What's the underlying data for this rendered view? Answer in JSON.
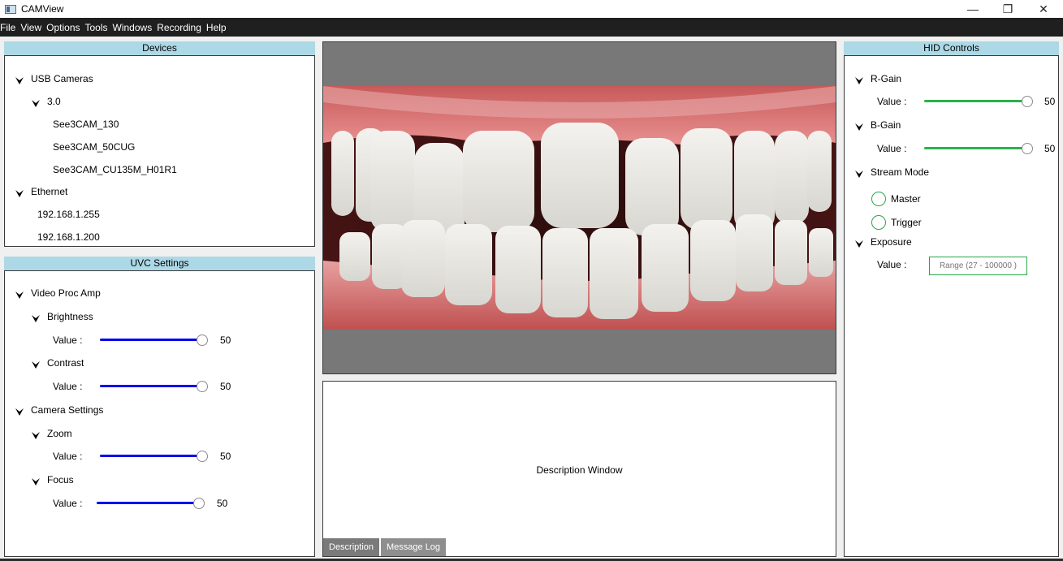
{
  "window": {
    "title": "CAMView",
    "minimize": "—",
    "restore": "❐",
    "close": "✕"
  },
  "menu": [
    "File",
    "View",
    "Options",
    "Tools",
    "Windows",
    "Recording",
    "Help"
  ],
  "devices": {
    "header": "Devices",
    "usb_cameras": "USB Cameras",
    "usb_version": "3.0",
    "cameras": [
      "See3CAM_130",
      "See3CAM_50CUG",
      "See3CAM_CU135M_H01R1"
    ],
    "ethernet": "Ethernet",
    "ethernet_ips": [
      "192.168.1.255",
      "192.168.1.200"
    ]
  },
  "uvc": {
    "header": "UVC Settings",
    "video_proc_amp": "Video Proc Amp",
    "brightness": "Brightness",
    "brightness_value": "50",
    "contrast": "Contrast",
    "contrast_value": "50",
    "camera_settings": "Camera Settings",
    "zoom": "Zoom",
    "zoom_value": "50",
    "focus": "Focus",
    "focus_value": "50",
    "value_label": "Value :"
  },
  "hid": {
    "header": "HID Controls",
    "r_gain": "R-Gain",
    "r_gain_value": "50",
    "b_gain": "B-Gain",
    "b_gain_value": "50",
    "stream_mode": "Stream Mode",
    "master": "Master",
    "trigger": "Trigger",
    "exposure": "Exposure",
    "exposure_placeholder": "Range (27 - 100000 )",
    "value_label": "Value :"
  },
  "description": {
    "title": "Description Window",
    "tabs": [
      "Description",
      "Message Log"
    ]
  },
  "colors": {
    "uvc_slider": "#0000ee",
    "hid_slider": "#2ab24a",
    "header_bg": "#add8e6",
    "menubar_bg": "#1f1f1f"
  },
  "icons": {
    "expand": "chevron-down-icon",
    "app": "camview-app-icon"
  }
}
